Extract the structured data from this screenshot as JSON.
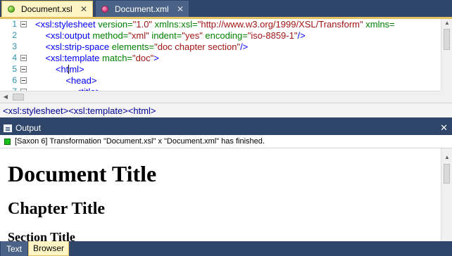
{
  "tabs": [
    {
      "label": "Document.xsl",
      "active": true,
      "icon": "xsl-file-icon"
    },
    {
      "label": "Document.xml",
      "active": false,
      "icon": "xml-file-icon"
    }
  ],
  "tab_close_glyph": "✕",
  "editor": {
    "line_numbers": [
      "1",
      "2",
      "3",
      "4",
      "5",
      "6",
      "7"
    ],
    "lines": [
      [
        {
          "c": "t",
          "s": "<xsl:stylesheet "
        },
        {
          "c": "a",
          "s": "version="
        },
        {
          "c": "v",
          "s": "\"1.0\" "
        },
        {
          "c": "a",
          "s": "xmlns:xsl="
        },
        {
          "c": "v",
          "s": "\"http://www.w3.org/1999/XSL/Transform\" "
        },
        {
          "c": "a",
          "s": "xmlns="
        }
      ],
      [
        {
          "c": "p",
          "s": "    "
        },
        {
          "c": "t",
          "s": "<xsl:output "
        },
        {
          "c": "a",
          "s": "method="
        },
        {
          "c": "v",
          "s": "\"xml\" "
        },
        {
          "c": "a",
          "s": "indent="
        },
        {
          "c": "v",
          "s": "\"yes\" "
        },
        {
          "c": "a",
          "s": "encoding="
        },
        {
          "c": "v",
          "s": "\"iso-8859-1\""
        },
        {
          "c": "t",
          "s": "/>"
        }
      ],
      [
        {
          "c": "p",
          "s": "    "
        },
        {
          "c": "t",
          "s": "<xsl:strip-space "
        },
        {
          "c": "a",
          "s": "elements="
        },
        {
          "c": "v",
          "s": "\"doc chapter section\""
        },
        {
          "c": "t",
          "s": "/>"
        }
      ],
      [
        {
          "c": "p",
          "s": "    "
        },
        {
          "c": "t",
          "s": "<xsl:template "
        },
        {
          "c": "a",
          "s": "match="
        },
        {
          "c": "v",
          "s": "\"doc\""
        },
        {
          "c": "t",
          "s": ">"
        }
      ],
      [
        {
          "c": "p",
          "s": "        "
        },
        {
          "c": "t",
          "s": "<ht"
        },
        {
          "c": "caret",
          "s": ""
        },
        {
          "c": "t",
          "s": "ml>"
        }
      ],
      [
        {
          "c": "p",
          "s": "            "
        },
        {
          "c": "t",
          "s": "<head>"
        }
      ],
      [
        {
          "c": "p",
          "s": "                "
        },
        {
          "c": "t",
          "s": "<title>"
        }
      ]
    ]
  },
  "breadcrumb": "<xsl:stylesheet><xsl:template><html>",
  "output": {
    "title": "Output",
    "close_glyph": "✕",
    "status": "[Saxon 6] Transformation \"Document.xsl\" x \"Document.xml\" has finished.",
    "status_color": "#19c019",
    "document": {
      "h1": "Document Title",
      "h2": "Chapter Title",
      "h3": "Section Title"
    }
  },
  "bottom_tabs": [
    {
      "label": "Text",
      "active": false
    },
    {
      "label": "Browser",
      "active": true
    }
  ],
  "colors": {
    "chrome": "#2f4569",
    "active_tab": "#fff5c4",
    "xml_tag": "#0000ff",
    "xml_attr": "#008000",
    "xml_value": "#a31515"
  }
}
